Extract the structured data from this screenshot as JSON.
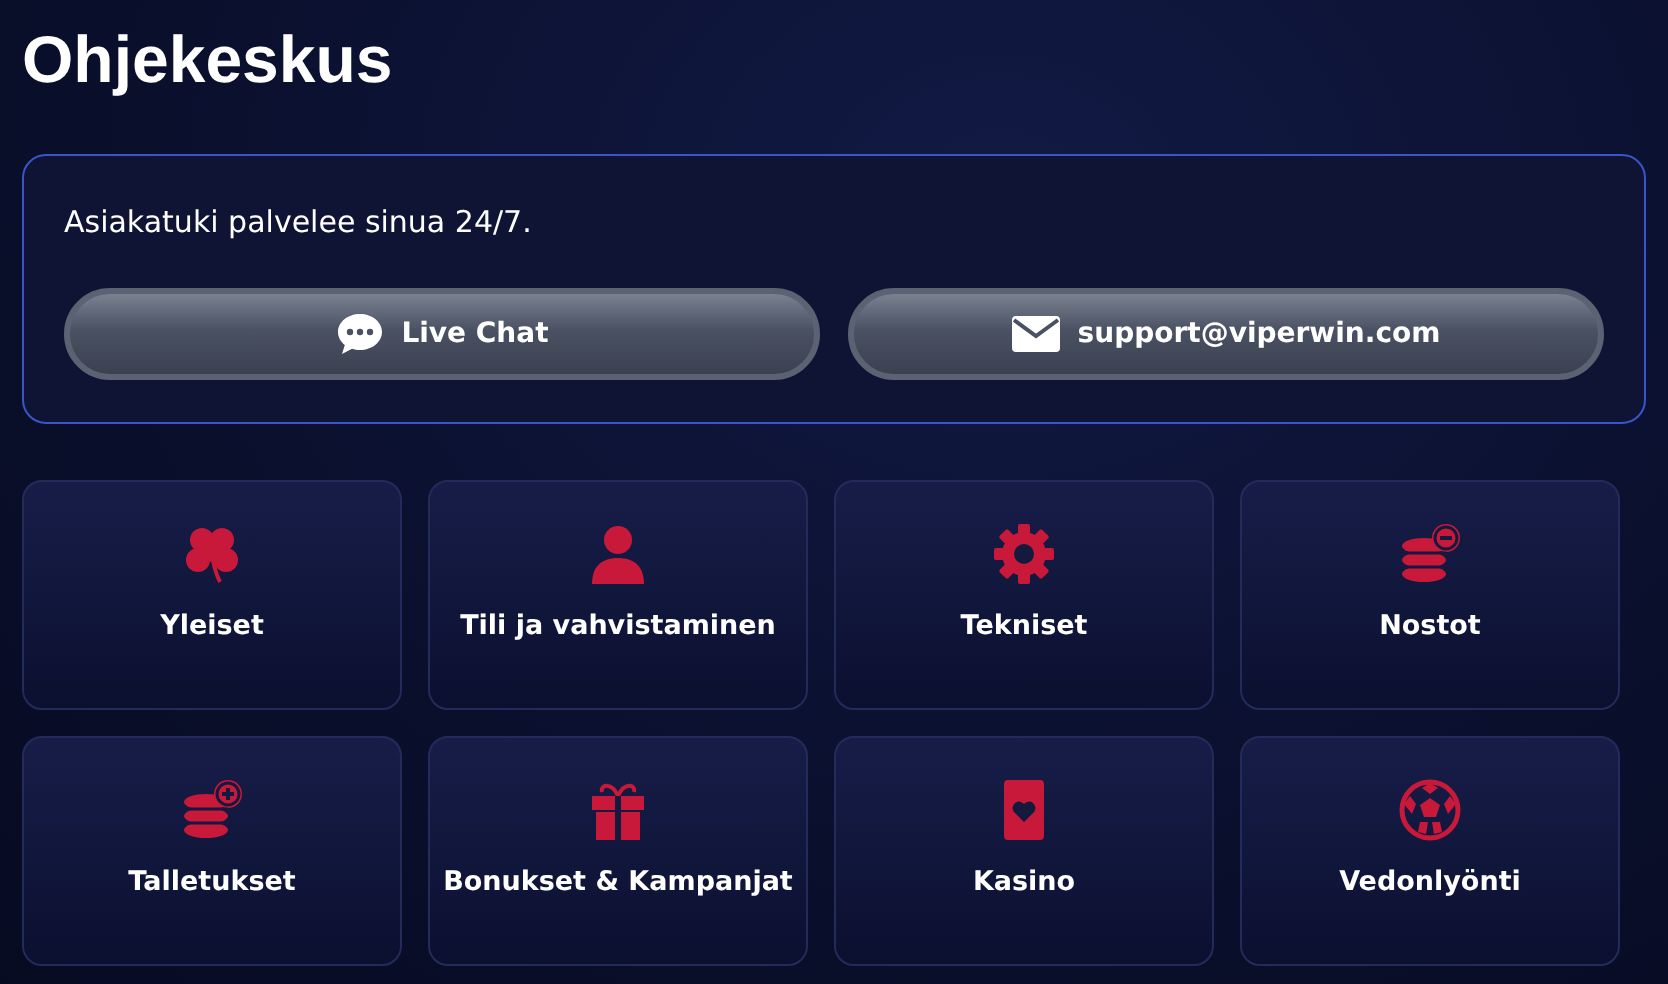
{
  "title": "Ohjekeskus",
  "support": {
    "text": "Asiakatuki palvelee sinua 24/7.",
    "buttons": [
      {
        "kind": "chat",
        "label": "Live Chat"
      },
      {
        "kind": "mail",
        "label": "support@viperwin.com"
      }
    ]
  },
  "categories": [
    {
      "kind": "clover",
      "label": "Yleiset"
    },
    {
      "kind": "person",
      "label": "Tili ja vahvistaminen"
    },
    {
      "kind": "gear",
      "label": "Tekniset"
    },
    {
      "kind": "coins-minus",
      "label": "Nostot"
    },
    {
      "kind": "coins-plus",
      "label": "Talletukset"
    },
    {
      "kind": "gift",
      "label": "Bonukset & Kampanjat"
    },
    {
      "kind": "card",
      "label": "Kasino"
    },
    {
      "kind": "ball",
      "label": "Vedonlyönti"
    }
  ]
}
